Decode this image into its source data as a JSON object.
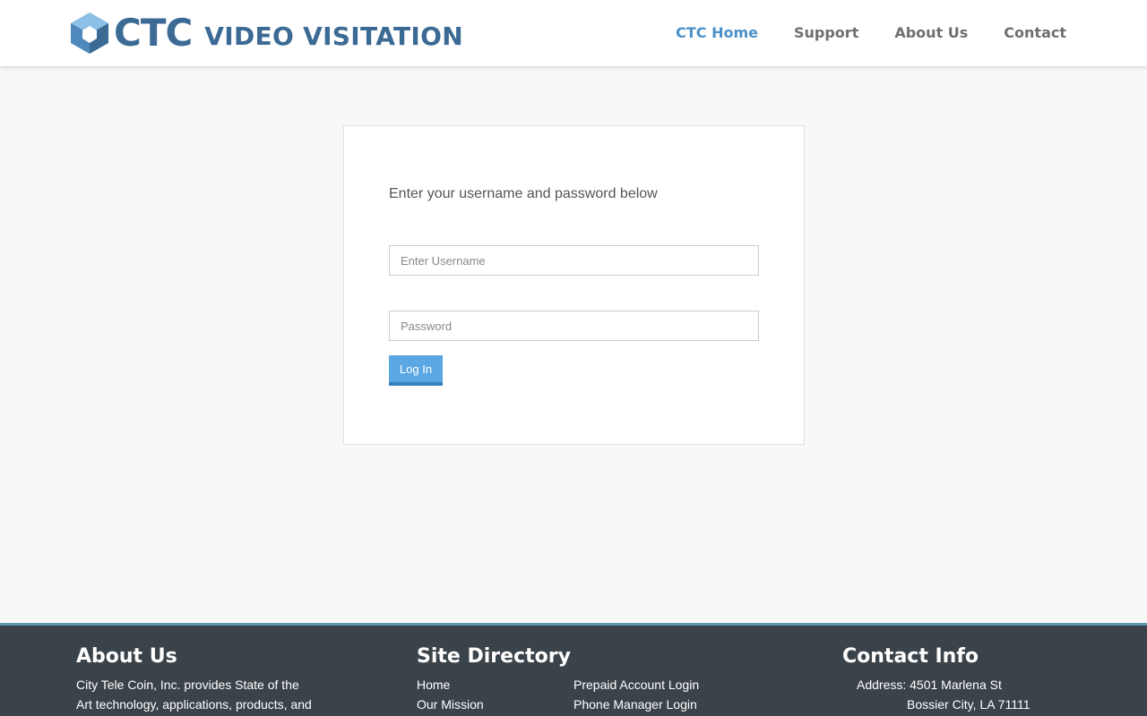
{
  "header": {
    "logo_ctc": "CTC",
    "logo_video_visitation": "VIDEO VISITATION",
    "nav": [
      {
        "label": "CTC Home",
        "active": true
      },
      {
        "label": "Support",
        "active": false
      },
      {
        "label": "About Us",
        "active": false
      },
      {
        "label": "Contact",
        "active": false
      }
    ]
  },
  "login": {
    "prompt": "Enter your username and password below",
    "username_placeholder": "Enter Username",
    "username_value": "",
    "password_placeholder": "Password",
    "password_value": "",
    "submit_label": "Log In"
  },
  "footer": {
    "about": {
      "heading": "About Us",
      "line1": "City Tele Coin, Inc. provides State of the",
      "line2": "Art technology, applications, products, and"
    },
    "directory": {
      "heading": "Site Directory",
      "links_col1": [
        "Home",
        "Our Mission"
      ],
      "links_col2": [
        "Prepaid Account Login",
        "Phone Manager Login"
      ]
    },
    "contact": {
      "heading": "Contact Info",
      "address_line1": "Address: 4501 Marlena St",
      "address_line2": "Bossier City, LA 71111"
    }
  },
  "colors": {
    "brand_blue": "#3b6a94",
    "nav_active": "#4a90c8",
    "button": "#5aa7e3",
    "footer_bg": "#3b434a"
  }
}
